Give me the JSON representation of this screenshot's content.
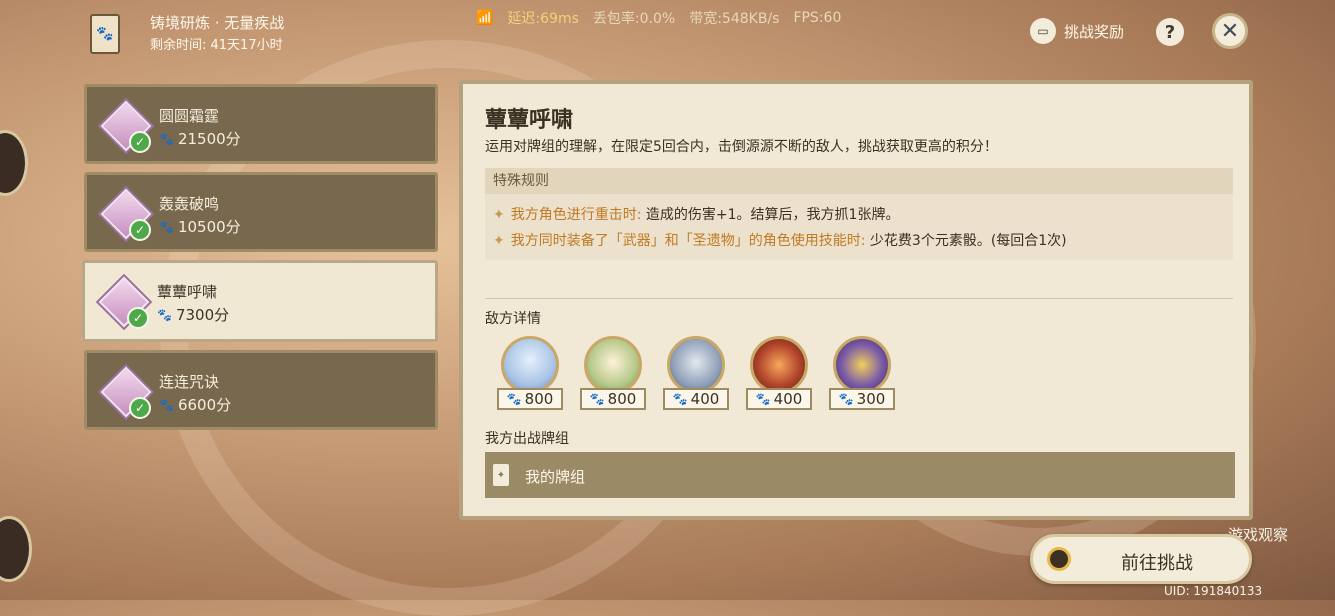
{
  "header": {
    "title": "铸境研炼 · 无量疾战",
    "remaining_time": "剩余时间: 41天17小时"
  },
  "net_stats": {
    "latency": "延迟:69ms",
    "packet_loss": "丢包率:0.0%",
    "bandwidth": "带宽:548KB/s",
    "fps": "FPS:60"
  },
  "top_actions": {
    "reward_label": "挑战奖励",
    "help_symbol": "?",
    "close_symbol": "✕"
  },
  "stages": [
    {
      "name": "圆圆霜霆",
      "score": "21500分"
    },
    {
      "name": "轰轰破鸣",
      "score": "10500分"
    },
    {
      "name": "蕈蕈呼啸",
      "score": "7300分"
    },
    {
      "name": "连连咒诀",
      "score": "6600分"
    }
  ],
  "panel": {
    "title": "蕈蕈呼啸",
    "description": "运用对牌组的理解，在限定5回合内，击倒源源不断的敌人，挑战获取更高的积分！",
    "special_rules_title": "特殊规则",
    "rules": [
      {
        "condition": "我方角色进行重击时:",
        "effect": "造成的伤害+1。结算后，我方抓1张牌。"
      },
      {
        "condition": "我方同时装备了「武器」和「圣遗物」的角色使用技能时:",
        "effect": "少花费3个元素骰。(每回合1次)"
      }
    ],
    "enemy_title": "敌方详情",
    "enemies": [
      {
        "icon": "ice-creature-icon",
        "points": "800",
        "color": "#a9c4e6"
      },
      {
        "icon": "forest-creature-icon",
        "points": "800",
        "color": "#b5c98a"
      },
      {
        "icon": "mech-creature-icon",
        "points": "400",
        "color": "#8fa0b8"
      },
      {
        "icon": "fire-creature-icon",
        "points": "400",
        "color": "#b2452c"
      },
      {
        "icon": "electro-creature-icon",
        "points": "300",
        "color": "#7b5ba8"
      }
    ],
    "deck_title": "我方出战牌组",
    "deck_label": "我的牌组"
  },
  "go_button_label": "前往挑战",
  "watermark": "游戏观察",
  "uid": "UID: 191840133",
  "colors": {
    "accent": "#c17a22",
    "panel_bg": "#f1e9d6",
    "stage_bg": "#78684d",
    "check_green": "#4fa84a"
  }
}
